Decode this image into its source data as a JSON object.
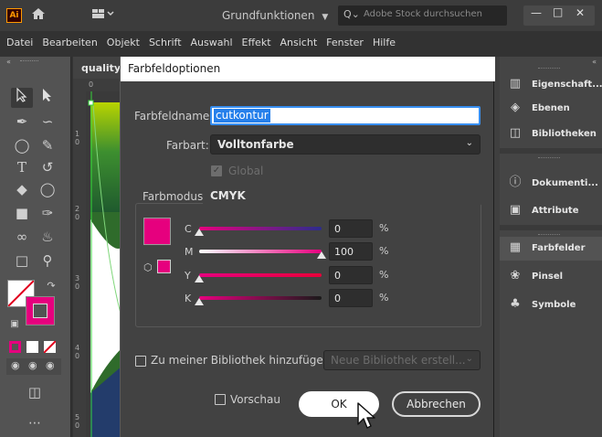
{
  "app": {
    "logo_text": "Ai",
    "workspace": "Grundfunktionen",
    "search_placeholder": "Adobe Stock durchsuchen",
    "accent_color": "#ff9a00"
  },
  "menu": {
    "items": [
      "Datei",
      "Bearbeiten",
      "Objekt",
      "Schrift",
      "Auswahl",
      "Effekt",
      "Ansicht",
      "Fenster",
      "Hilfe"
    ]
  },
  "document": {
    "tab_label": "quality",
    "ruler_top": "0",
    "ruler_left_labels": [
      "1\n0",
      "2\n0",
      "3\n0",
      "4\n0",
      "5\n0"
    ]
  },
  "dialog": {
    "title": "Farbfeldoptionen",
    "name_label": "Farbfeldname:",
    "name_value": "cutkontur",
    "type_label": "Farbart:",
    "type_value": "Volltonfarbe",
    "global_label": "Global",
    "mode_label": "Farbmodus:",
    "mode_value": "CMYK",
    "swatch_color": "#e6007e",
    "channels": [
      {
        "name": "C",
        "value": "0",
        "unit": "%",
        "level": 0
      },
      {
        "name": "M",
        "value": "100",
        "unit": "%",
        "level": 100
      },
      {
        "name": "Y",
        "value": "0",
        "unit": "%",
        "level": 0
      },
      {
        "name": "K",
        "value": "0",
        "unit": "%",
        "level": 0
      }
    ],
    "library_label": "Zu meiner Bibliothek hinzufügen",
    "library_dropdown": "Neue Bibliothek erstell...",
    "preview_label": "Vorschau",
    "ok_label": "OK",
    "cancel_label": "Abbrechen"
  },
  "panels": {
    "items": [
      {
        "label": "Eigenschaft...",
        "icon": "properties-icon"
      },
      {
        "label": "Ebenen",
        "icon": "layers-icon"
      },
      {
        "label": "Bibliotheken",
        "icon": "libraries-icon"
      },
      {
        "label": "Dokumenti...",
        "icon": "document-info-icon"
      },
      {
        "label": "Attribute",
        "icon": "attributes-icon"
      },
      {
        "label": "Farbfelder",
        "icon": "swatches-icon",
        "selected": true
      },
      {
        "label": "Pinsel",
        "icon": "brushes-icon"
      },
      {
        "label": "Symbole",
        "icon": "symbols-icon"
      }
    ]
  }
}
